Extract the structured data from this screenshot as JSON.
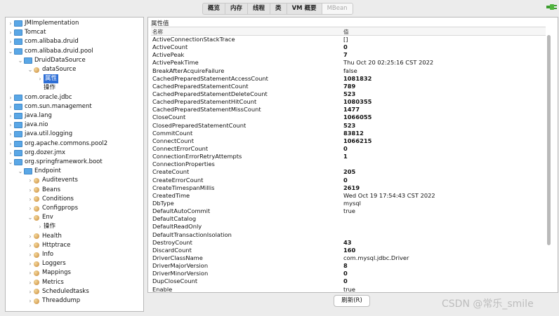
{
  "toolbar": {
    "tabs": [
      "概览",
      "内存",
      "线程",
      "类",
      "VM 概要",
      "MBean"
    ],
    "active_tab": "MBean"
  },
  "tree": [
    {
      "label": "JMImplementation",
      "icon": "folder-icon",
      "arrow": "›",
      "depth": 0
    },
    {
      "label": "Tomcat",
      "icon": "folder-icon",
      "arrow": "›",
      "depth": 0
    },
    {
      "label": "com.alibaba.druid",
      "icon": "folder-icon",
      "arrow": "›",
      "depth": 0
    },
    {
      "label": "com.alibaba.druid.pool",
      "icon": "folder-icon",
      "arrow": "⌄",
      "depth": 0
    },
    {
      "label": "DruidDataSource",
      "icon": "folder-icon",
      "arrow": "⌄",
      "depth": 1
    },
    {
      "label": "dataSource",
      "icon": "bean-icon",
      "arrow": "⌄",
      "depth": 2
    },
    {
      "label": "属性",
      "icon": "",
      "arrow": "›",
      "depth": 3,
      "selected": true
    },
    {
      "label": "操作",
      "icon": "",
      "arrow": "",
      "depth": 3
    },
    {
      "label": "com.oracle.jdbc",
      "icon": "folder-icon",
      "arrow": "›",
      "depth": 0
    },
    {
      "label": "com.sun.management",
      "icon": "folder-icon",
      "arrow": "›",
      "depth": 0
    },
    {
      "label": "java.lang",
      "icon": "folder-icon",
      "arrow": "›",
      "depth": 0
    },
    {
      "label": "java.nio",
      "icon": "folder-icon",
      "arrow": "›",
      "depth": 0
    },
    {
      "label": "java.util.logging",
      "icon": "folder-icon",
      "arrow": "›",
      "depth": 0
    },
    {
      "label": "org.apache.commons.pool2",
      "icon": "folder-icon",
      "arrow": "›",
      "depth": 0
    },
    {
      "label": "org.dozer.jmx",
      "icon": "folder-icon",
      "arrow": "›",
      "depth": 0
    },
    {
      "label": "org.springframework.boot",
      "icon": "folder-icon",
      "arrow": "⌄",
      "depth": 0
    },
    {
      "label": "Endpoint",
      "icon": "folder-icon",
      "arrow": "⌄",
      "depth": 1
    },
    {
      "label": "Auditevents",
      "icon": "bean-icon",
      "arrow": "›",
      "depth": 2
    },
    {
      "label": "Beans",
      "icon": "bean-icon",
      "arrow": "›",
      "depth": 2
    },
    {
      "label": "Conditions",
      "icon": "bean-icon",
      "arrow": "›",
      "depth": 2
    },
    {
      "label": "Configprops",
      "icon": "bean-icon",
      "arrow": "›",
      "depth": 2
    },
    {
      "label": "Env",
      "icon": "bean-icon",
      "arrow": "⌄",
      "depth": 2
    },
    {
      "label": "操作",
      "icon": "",
      "arrow": "›",
      "depth": 3
    },
    {
      "label": "Health",
      "icon": "bean-icon",
      "arrow": "›",
      "depth": 2
    },
    {
      "label": "Httptrace",
      "icon": "bean-icon",
      "arrow": "›",
      "depth": 2
    },
    {
      "label": "Info",
      "icon": "bean-icon",
      "arrow": "›",
      "depth": 2
    },
    {
      "label": "Loggers",
      "icon": "bean-icon",
      "arrow": "›",
      "depth": 2
    },
    {
      "label": "Mappings",
      "icon": "bean-icon",
      "arrow": "›",
      "depth": 2
    },
    {
      "label": "Metrics",
      "icon": "bean-icon",
      "arrow": "›",
      "depth": 2
    },
    {
      "label": "Scheduledtasks",
      "icon": "bean-icon",
      "arrow": "›",
      "depth": 2
    },
    {
      "label": "Threaddump",
      "icon": "bean-icon",
      "arrow": "›",
      "depth": 2
    }
  ],
  "panel": {
    "title": "属性值",
    "col_name": "名称",
    "col_value": "值",
    "rows": [
      {
        "name": "ActiveConnectionStackTrace",
        "value": "[]",
        "bold": false
      },
      {
        "name": "ActiveCount",
        "value": "0",
        "bold": true
      },
      {
        "name": "ActivePeak",
        "value": "7",
        "bold": true
      },
      {
        "name": "ActivePeakTime",
        "value": "Thu Oct 20 02:25:16 CST 2022",
        "bold": false
      },
      {
        "name": "BreakAfterAcquireFailure",
        "value": "false",
        "bold": false
      },
      {
        "name": "CachedPreparedStatementAccessCount",
        "value": "1081832",
        "bold": true
      },
      {
        "name": "CachedPreparedStatementCount",
        "value": "789",
        "bold": true
      },
      {
        "name": "CachedPreparedStatementDeleteCount",
        "value": "523",
        "bold": true
      },
      {
        "name": "CachedPreparedStatementHitCount",
        "value": "1080355",
        "bold": true
      },
      {
        "name": "CachedPreparedStatementMissCount",
        "value": "1477",
        "bold": true
      },
      {
        "name": "CloseCount",
        "value": "1066055",
        "bold": true
      },
      {
        "name": "ClosedPreparedStatementCount",
        "value": "523",
        "bold": true
      },
      {
        "name": "CommitCount",
        "value": "83812",
        "bold": true
      },
      {
        "name": "ConnectCount",
        "value": "1066215",
        "bold": true
      },
      {
        "name": "ConnectErrorCount",
        "value": "0",
        "bold": true
      },
      {
        "name": "ConnectionErrorRetryAttempts",
        "value": "1",
        "bold": true
      },
      {
        "name": "ConnectionProperties",
        "value": "",
        "bold": false
      },
      {
        "name": "CreateCount",
        "value": "205",
        "bold": true
      },
      {
        "name": "CreateErrorCount",
        "value": "0",
        "bold": true
      },
      {
        "name": "CreateTimespanMillis",
        "value": "2619",
        "bold": true
      },
      {
        "name": "CreatedTime",
        "value": "Wed Oct 19 17:54:43 CST 2022",
        "bold": false
      },
      {
        "name": "DbType",
        "value": "mysql",
        "bold": false
      },
      {
        "name": "DefaultAutoCommit",
        "value": "true",
        "bold": false
      },
      {
        "name": "DefaultCatalog",
        "value": "",
        "bold": false
      },
      {
        "name": "DefaultReadOnly",
        "value": "",
        "bold": false
      },
      {
        "name": "DefaultTransactionIsolation",
        "value": "",
        "bold": false
      },
      {
        "name": "DestroyCount",
        "value": "43",
        "bold": true
      },
      {
        "name": "DiscardCount",
        "value": "160",
        "bold": true
      },
      {
        "name": "DriverClassName",
        "value": "com.mysql.jdbc.Driver",
        "bold": false
      },
      {
        "name": "DriverMajorVersion",
        "value": "8",
        "bold": true
      },
      {
        "name": "DriverMinorVersion",
        "value": "0",
        "bold": true
      },
      {
        "name": "DupCloseCount",
        "value": "0",
        "bold": true
      },
      {
        "name": "Enable",
        "value": "true",
        "bold": false
      }
    ]
  },
  "refresh_label": "刷新(R)",
  "watermark": "CSDN @常乐_smile"
}
